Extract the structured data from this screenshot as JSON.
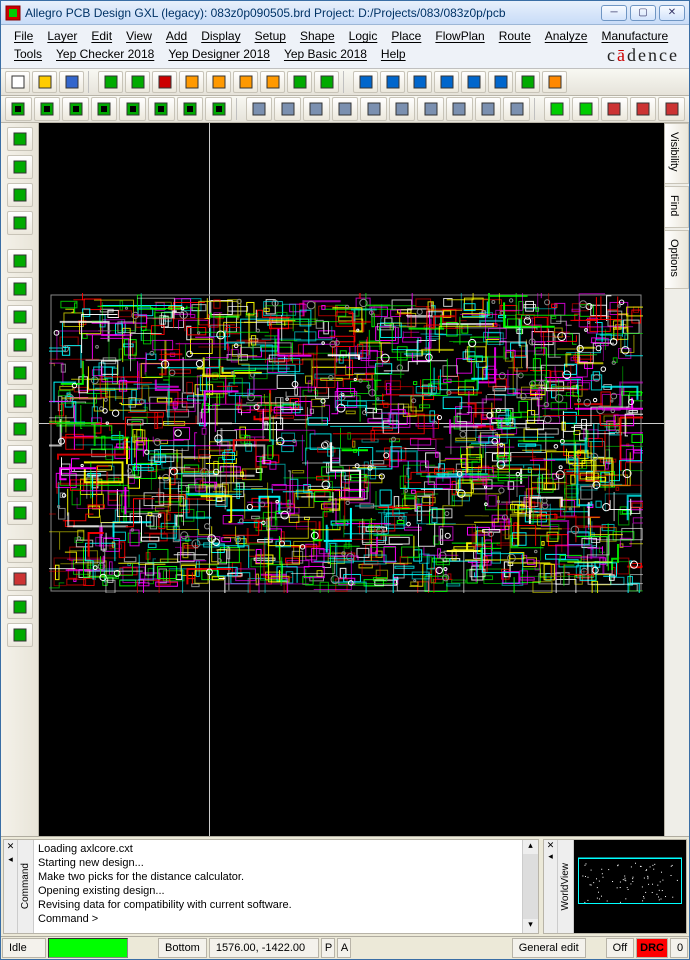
{
  "title": "Allegro PCB Design GXL (legacy): 083z0p090505.brd  Project: D:/Projects/083/083z0p/pcb",
  "menus": [
    "File",
    "Layer",
    "Edit",
    "View",
    "Add",
    "Display",
    "Setup",
    "Shape",
    "Logic",
    "Place",
    "FlowPlan",
    "Route",
    "Analyze",
    "Manufacture",
    "Tools",
    "Yep Checker 2018",
    "Yep Designer 2018",
    "Yep Basic 2018",
    "Help"
  ],
  "brand": "cādence",
  "right_tabs": [
    "Visibility",
    "Find",
    "Options"
  ],
  "command_panel": {
    "label": "Command",
    "lines": [
      "Loading axlcore.cxt",
      "Starting new design...",
      "Make two picks for the distance calculator.",
      "Opening existing design...",
      "Revising data for compatibility with current software.",
      "Command >"
    ]
  },
  "worldview": {
    "label": "WorldView"
  },
  "status": {
    "idle": "Idle",
    "layer": "Bottom",
    "coords": "1576.00, -1422.00",
    "p": "P",
    "a": "A",
    "mode": "General edit",
    "drc_state": "Off",
    "drc_label": "DRC",
    "drc_count": "0"
  },
  "toolbar1_icons": [
    "new-icon",
    "open-icon",
    "save-icon",
    "sep",
    "move-icon",
    "copy-icon",
    "delete-icon",
    "undo-icon",
    "redo-icon",
    "arrow-down-icon",
    "arrow-down2-icon",
    "drc-marker-icon",
    "pin-icon",
    "sep",
    "zoom-window-icon",
    "zoom-fit-icon",
    "zoom-in-icon",
    "zoom-out-icon",
    "zoom-prev-icon",
    "zoom-sel-icon",
    "refresh-icon",
    "3d-icon"
  ],
  "toolbar2_icons": [
    "layer1-icon",
    "layer2-icon",
    "layer3-icon",
    "layer4-icon",
    "layer5-icon",
    "layer6-icon",
    "layer7-icon",
    "layer8-icon",
    "sep",
    "shape1-icon",
    "shape2-icon",
    "shape3-icon",
    "select-icon",
    "grid1-icon",
    "grid2-icon",
    "grid3-icon",
    "grid4-icon",
    "grid5-icon",
    "grid6-icon",
    "sep",
    "highlight1-icon",
    "highlight2-icon",
    "dim-h-icon",
    "dim-v-icon",
    "dim-ref-icon"
  ],
  "left_tools": [
    "chip-icon",
    "ic-icon",
    "conn-icon",
    "info-icon",
    "sep",
    "route-icon",
    "slide-icon",
    "via-icon",
    "diff-icon",
    "tune-icon",
    "net-icon",
    "plane-icon",
    "fanout-icon",
    "bus-icon",
    "spread-icon",
    "sep",
    "wire-icon",
    "dim-icon",
    "text-add-icon",
    "text-edit-icon"
  ]
}
